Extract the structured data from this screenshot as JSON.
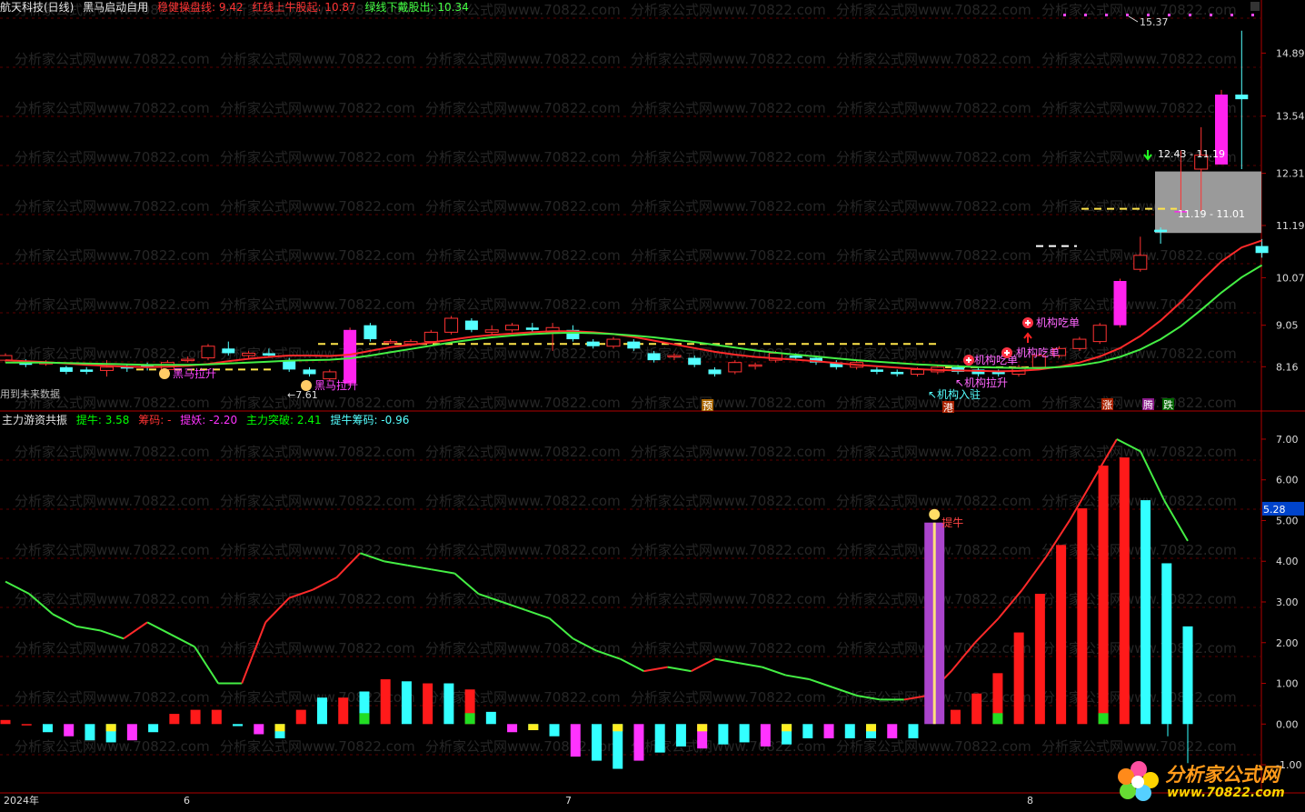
{
  "header": {
    "stock": "航天科技(日线)",
    "indicator": "黑马启动自用",
    "line1_label": "稳健操盘线: 9.42",
    "line2_label": "红线上牛股起: 10.87",
    "line3_label": "绿线下戴股出: 10.34"
  },
  "lower_header": {
    "indicator": "主力游资共振",
    "items": [
      {
        "label": "提牛: 3.58",
        "color": "#00ff00"
      },
      {
        "label": "筹码: -",
        "color": "#ff3333"
      },
      {
        "label": "提妖: -2.20",
        "color": "#ff33ff"
      },
      {
        "label": "主力突破: 2.41",
        "color": "#00ff00"
      },
      {
        "label": "提牛筹码: -0.96",
        "color": "#55ffff"
      }
    ]
  },
  "watermark": "分析家公式网www.70822.com",
  "upper_axis": [
    "14.89",
    "13.54",
    "12.31",
    "11.19",
    "10.07",
    "9.05",
    "8.16"
  ],
  "lower_axis": [
    "7.00",
    "6.00",
    "5.00",
    "4.00",
    "3.00",
    "2.00",
    "1.00",
    "0.00",
    "-1.00"
  ],
  "lower_axis_highlight": "5.28",
  "annotations": {
    "high_price": "15.37",
    "zone_top": "12.43 - 11.19",
    "zone_bottom": "11.19 - 11.01",
    "future_data": "用到未来数据",
    "low_marker": "7.61",
    "heima1": "黑马拉升",
    "heima2": "黑马拉升",
    "jigou_laisheng": "机构拉升",
    "jigou_ruzhu": "机构入驻",
    "jigou_chidan1": "机构吃单",
    "jigou_chidan2": "机构吃单",
    "jigou_chidan3": "机构吃单",
    "tiniu": "提牛"
  },
  "badges": {
    "yu": "预",
    "gang": "港",
    "zhang": "涨",
    "teng": "腾",
    "die": "跌"
  },
  "time_axis": {
    "year": "2024年",
    "m6": "6",
    "m7": "7",
    "m8": "8"
  },
  "logo": {
    "title": "分析家公式网",
    "url": "www.70822.com"
  },
  "chart_data": {
    "type": "candlestick",
    "candles": [
      [
        8.3,
        8.4,
        8.45,
        8.25
      ],
      [
        8.28,
        8.2,
        8.32,
        8.15
      ],
      [
        8.22,
        8.25,
        8.3,
        8.18
      ],
      [
        8.15,
        8.05,
        8.18,
        8.0
      ],
      [
        8.1,
        8.05,
        8.15,
        8.0
      ],
      [
        8.08,
        8.15,
        8.3,
        7.95
      ],
      [
        8.15,
        8.12,
        8.2,
        8.05
      ],
      [
        8.2,
        8.15,
        8.25,
        8.08
      ],
      [
        8.1,
        8.25,
        8.3,
        8.05
      ],
      [
        8.3,
        8.32,
        8.38,
        8.25
      ],
      [
        8.35,
        8.6,
        8.65,
        8.3
      ],
      [
        8.55,
        8.45,
        8.7,
        8.4
      ],
      [
        8.4,
        8.45,
        8.5,
        8.35
      ],
      [
        8.45,
        8.4,
        8.55,
        8.38
      ],
      [
        8.3,
        8.1,
        8.35,
        8.05
      ],
      [
        8.1,
        8.0,
        8.15,
        7.95
      ],
      [
        7.9,
        8.05,
        8.1,
        7.85
      ],
      [
        7.8,
        8.95,
        9.0,
        7.75
      ],
      [
        9.05,
        8.75,
        9.1,
        8.7
      ],
      [
        8.7,
        8.7,
        8.75,
        8.65
      ],
      [
        8.65,
        8.7,
        8.75,
        8.6
      ],
      [
        8.7,
        8.9,
        8.95,
        8.65
      ],
      [
        8.9,
        9.2,
        9.25,
        8.85
      ],
      [
        9.15,
        8.95,
        9.2,
        8.9
      ],
      [
        8.9,
        8.95,
        9.05,
        8.85
      ],
      [
        8.95,
        9.05,
        9.1,
        8.9
      ],
      [
        9.0,
        8.95,
        9.1,
        8.9
      ],
      [
        8.9,
        9.0,
        9.1,
        8.5
      ],
      [
        8.95,
        8.75,
        9.05,
        8.7
      ],
      [
        8.7,
        8.6,
        8.75,
        8.55
      ],
      [
        8.6,
        8.75,
        8.8,
        8.55
      ],
      [
        8.7,
        8.55,
        8.75,
        8.5
      ],
      [
        8.45,
        8.3,
        8.5,
        8.25
      ],
      [
        8.4,
        8.4,
        8.45,
        8.3
      ],
      [
        8.35,
        8.2,
        8.4,
        8.15
      ],
      [
        8.1,
        8.0,
        8.15,
        7.95
      ],
      [
        8.05,
        8.25,
        8.3,
        8.0
      ],
      [
        8.2,
        8.2,
        8.25,
        8.1
      ],
      [
        8.3,
        8.45,
        8.5,
        8.25
      ],
      [
        8.4,
        8.35,
        8.45,
        8.3
      ],
      [
        8.35,
        8.25,
        8.4,
        8.2
      ],
      [
        8.25,
        8.15,
        8.3,
        8.1
      ],
      [
        8.15,
        8.25,
        8.3,
        8.1
      ],
      [
        8.1,
        8.05,
        8.15,
        8.0
      ],
      [
        8.05,
        8.0,
        8.1,
        7.95
      ],
      [
        8.0,
        8.1,
        8.15,
        7.95
      ],
      [
        8.05,
        8.15,
        8.2,
        8.0
      ],
      [
        8.15,
        8.05,
        8.2,
        8.0
      ],
      [
        8.1,
        8.0,
        8.15,
        7.95
      ],
      [
        8.05,
        8.0,
        8.1,
        7.95
      ],
      [
        8.0,
        8.15,
        8.2,
        7.95
      ],
      [
        8.15,
        8.4,
        8.45,
        8.1
      ],
      [
        8.4,
        8.55,
        8.6,
        8.35
      ],
      [
        8.55,
        8.75,
        8.8,
        8.5
      ],
      [
        8.7,
        9.05,
        9.1,
        8.65
      ],
      [
        9.05,
        10.0,
        10.05,
        9.0
      ],
      [
        10.25,
        10.55,
        10.95,
        10.2
      ],
      [
        11.1,
        11.05,
        11.15,
        10.8
      ],
      [
        11.5,
        11.5,
        12.8,
        11.5
      ],
      [
        12.4,
        12.7,
        13.3,
        11.5
      ],
      [
        12.5,
        14.0,
        14.1,
        12.5
      ],
      [
        14.0,
        13.9,
        15.37,
        12.4
      ],
      [
        10.75,
        10.6,
        10.9,
        10.5
      ]
    ],
    "ma_red": [
      8.3,
      8.28,
      8.26,
      8.23,
      8.2,
      8.18,
      8.16,
      8.15,
      8.16,
      8.18,
      8.22,
      8.28,
      8.33,
      8.37,
      8.4,
      8.4,
      8.39,
      8.42,
      8.5,
      8.58,
      8.63,
      8.68,
      8.74,
      8.8,
      8.84,
      8.87,
      8.9,
      8.92,
      8.92,
      8.9,
      8.86,
      8.8,
      8.72,
      8.64,
      8.56,
      8.48,
      8.42,
      8.37,
      8.34,
      8.31,
      8.28,
      8.24,
      8.2,
      8.17,
      8.14,
      8.11,
      8.09,
      8.08,
      8.07,
      8.06,
      8.07,
      8.1,
      8.16,
      8.25,
      8.38,
      8.56,
      8.82,
      9.15,
      9.55,
      10.0,
      10.42,
      10.72,
      10.87
    ],
    "ma_green": [
      8.25,
      8.25,
      8.25,
      8.24,
      8.23,
      8.22,
      8.21,
      8.2,
      8.2,
      8.2,
      8.21,
      8.23,
      8.25,
      8.27,
      8.29,
      8.3,
      8.31,
      8.34,
      8.4,
      8.47,
      8.54,
      8.61,
      8.68,
      8.74,
      8.79,
      8.83,
      8.86,
      8.88,
      8.89,
      8.88,
      8.86,
      8.83,
      8.79,
      8.74,
      8.69,
      8.63,
      8.57,
      8.51,
      8.46,
      8.42,
      8.38,
      8.34,
      8.3,
      8.27,
      8.24,
      8.21,
      8.19,
      8.17,
      8.15,
      8.14,
      8.13,
      8.13,
      8.15,
      8.19,
      8.26,
      8.37,
      8.53,
      8.75,
      9.03,
      9.38,
      9.75,
      10.08,
      10.34
    ],
    "osc_line": [
      3.5,
      3.2,
      2.7,
      2.4,
      2.3,
      2.1,
      2.5,
      2.2,
      1.9,
      1.0,
      1.0,
      2.5,
      3.1,
      3.3,
      3.6,
      4.2,
      4.0,
      3.9,
      3.8,
      3.7,
      3.2,
      3.0,
      2.8,
      2.6,
      2.1,
      1.8,
      1.6,
      1.3,
      1.4,
      1.3,
      1.6,
      1.5,
      1.4,
      1.2,
      1.1,
      0.9,
      0.7,
      0.6,
      0.6,
      0.7,
      1.3,
      2.0,
      2.6,
      3.3,
      4.1,
      5.0,
      6.0,
      7.0,
      6.7,
      5.5,
      4.5
    ],
    "histogram": [
      0.1,
      0.0,
      -0.2,
      -0.3,
      -0.4,
      -0.45,
      -0.4,
      -0.2,
      0.25,
      0.35,
      0.35,
      -0.05,
      -0.25,
      -0.35,
      0.35,
      0.65,
      0.65,
      0.8,
      1.1,
      1.05,
      1.0,
      1.0,
      0.85,
      0.3,
      -0.2,
      -0.15,
      -0.3,
      -0.8,
      -0.9,
      -1.1,
      -0.9,
      -0.7,
      -0.55,
      -0.6,
      -0.5,
      -0.45,
      -0.55,
      -0.5,
      -0.35,
      -0.35,
      -0.35,
      -0.35,
      -0.35,
      -0.35,
      4.95,
      0.35,
      0.75,
      1.25,
      2.25,
      3.2,
      4.4,
      5.3,
      6.35,
      6.55,
      5.5,
      3.95,
      2.4
    ],
    "osc_ylim": [
      -1.2,
      7.2
    ],
    "price_ylim": [
      7.6,
      15.6
    ],
    "reference_levels": {
      "dashed_yellow": [
        8.65,
        8.15,
        11.55,
        10.75
      ]
    }
  }
}
